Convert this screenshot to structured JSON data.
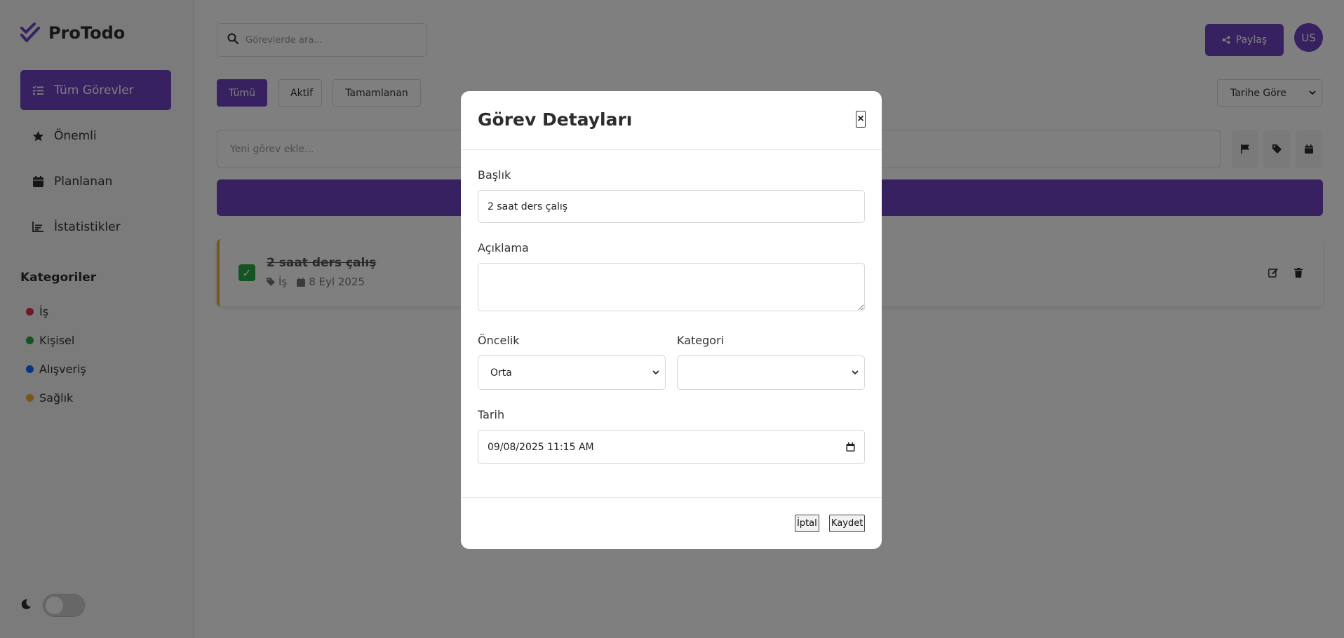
{
  "app": {
    "name": "ProTodo"
  },
  "sidebar": {
    "items": [
      {
        "label": "Tüm Görevler",
        "icon": "list-check-icon"
      },
      {
        "label": "Önemli",
        "icon": "star-icon"
      },
      {
        "label": "Planlanan",
        "icon": "calendar-icon"
      },
      {
        "label": "İstatistikler",
        "icon": "chart-icon"
      }
    ],
    "categories_title": "Kategoriler",
    "categories": [
      {
        "label": "İş",
        "color": "#dc3545"
      },
      {
        "label": "Kişisel",
        "color": "#28a745"
      },
      {
        "label": "Alışveriş",
        "color": "#0d6efd"
      },
      {
        "label": "Sağlık",
        "color": "#f0ad2c"
      }
    ],
    "dark_mode": false
  },
  "header": {
    "search_placeholder": "Görevlerde ara...",
    "share_label": "Paylaş",
    "avatar_initials": "US"
  },
  "filters": {
    "tabs": [
      "Tümü",
      "Aktif",
      "Tamamlanan"
    ],
    "active_tab": "Tümü",
    "sort_value": "Tarihe Göre"
  },
  "new_task": {
    "placeholder": "Yeni görev ekle..."
  },
  "tasks": [
    {
      "title": "2 saat ders çalış",
      "category": "İş",
      "date": "8 Eyl 2025",
      "completed": true,
      "priority_color": "#f0ad2c"
    }
  ],
  "modal": {
    "title": "Görev Detayları",
    "close_label": "×",
    "fields": {
      "title_label": "Başlık",
      "title_value": "2 saat ders çalış",
      "description_label": "Açıklama",
      "description_value": "",
      "priority_label": "Öncelik",
      "priority_value": "Orta",
      "category_label": "Kategori",
      "category_value": "",
      "date_label": "Tarih",
      "date_value": "09/08/2025 11:15 AM"
    },
    "cancel_label": "İptal",
    "save_label": "Kaydet"
  },
  "colors": {
    "accent": "#6f42c1",
    "completed": "#28a745",
    "overlay": "rgba(0,0,0,0.5)"
  }
}
